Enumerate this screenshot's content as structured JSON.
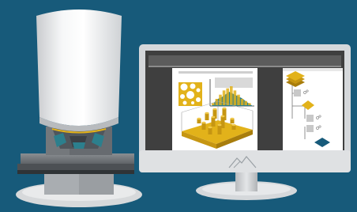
{
  "scene": {
    "background_color": "#175a7a",
    "accent_color": "#e2b21a",
    "monitor_color": "#d5d8db",
    "dark_panel_color": "#3f3f3f"
  },
  "monitor": {
    "logo_icon": "mountain-peaks-icon"
  },
  "left_panel": {
    "histogram_values": [
      1,
      3,
      5,
      7,
      8,
      9,
      7,
      5,
      3,
      2,
      1
    ]
  },
  "right_panel": {
    "workflow_icons": [
      "layer-stack-icon",
      "process-box-icon",
      "diamond-node-icon",
      "process-box-icon",
      "process-box-icon",
      "teal-diamond-icon"
    ]
  }
}
